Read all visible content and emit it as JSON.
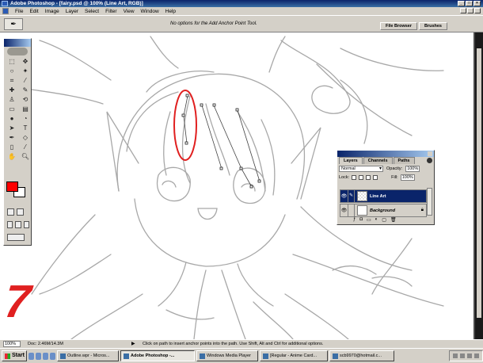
{
  "app": {
    "title": "Adobe Photoshop - [fairy.psd @ 100% (Line Art, RGB)]"
  },
  "menu": [
    "File",
    "Edit",
    "Image",
    "Layer",
    "Select",
    "Filter",
    "View",
    "Window",
    "Help"
  ],
  "options_bar": {
    "message": "No options for the Add Anchor Point Tool.",
    "palette_well": [
      "File Browser",
      "Brushes"
    ]
  },
  "layers_palette": {
    "tabs": [
      "Layers",
      "Channels",
      "Paths"
    ],
    "blend_mode": "Normal",
    "opacity_label": "Opacity:",
    "opacity_value": "100%",
    "lock_label": "Lock:",
    "fill_label": "Fill:",
    "fill_value": "100%",
    "layers": [
      {
        "name": "Line Art",
        "selected": true
      },
      {
        "name": "Background",
        "selected": false
      }
    ]
  },
  "step_number": "7",
  "status_bar": {
    "zoom": "100%",
    "doc": "Doc: 2.46M/14.3M",
    "hint": "Click on path to insert anchor points into the path. Use Shift, Alt and Ctrl for additional options."
  },
  "taskbar": {
    "start_label": "Start",
    "tasks": [
      {
        "label": "Outline.wpr - Micros...",
        "active": false
      },
      {
        "label": "Adobe Photoshop -...",
        "active": true
      },
      {
        "label": "Windows Media Player",
        "active": false
      },
      {
        "label": "[Regular - Anime Card...",
        "active": false
      },
      {
        "label": "scb9970@hotmail.c...",
        "active": false
      }
    ]
  },
  "colors": {
    "foreground": "#ff0000",
    "background": "#ffffff",
    "selection_ellipse": "#e02020",
    "step_number": "#e02020"
  }
}
